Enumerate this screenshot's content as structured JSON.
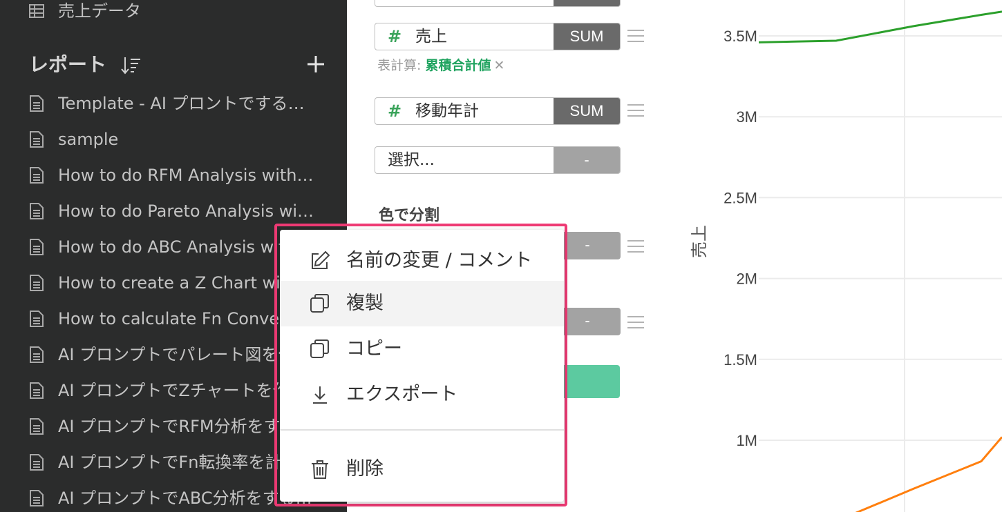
{
  "sidebar": {
    "top_item": "売上データ",
    "reports_title": "レポート",
    "reports": [
      "Template - AI プロントでするグラフの作成方法",
      "sample",
      "How to do RFM Analysis with AI Prompt",
      "How to do Pareto Analysis with AI Prompt",
      "How to do ABC Analysis with AI Prompt",
      "How to create a Z Chart with AI Prompt",
      "How to calculate Fn Conversion Rate with AI Prompt",
      "AI プロンプトでパレート図を作成する方法",
      "AI プロンプトでZチャートを作成する方法",
      "AI プロンプトでRFM分析をする方法",
      "AI プロンプトでFn転換率を計算する方法",
      "AI プロンプトでABC分析をする方法"
    ]
  },
  "panel": {
    "fields": [
      {
        "hash": "#",
        "name": "売上",
        "agg": "SUM"
      },
      {
        "hash": "#",
        "name": "移動年計",
        "agg": "SUM"
      }
    ],
    "select_placeholder": "選択...",
    "select_agg": "-",
    "dash": "-",
    "table_calc_label": "表計算: ",
    "table_calc_value": "累積合計値",
    "remove_symbol": "✕",
    "color_split_label": "色で分割"
  },
  "chart_data": {
    "type": "line",
    "ylabel": "売上",
    "yticks": [
      "3.5M",
      "3M",
      "2.5M",
      "2M",
      "1.5M",
      "1M"
    ],
    "ylim": [
      600000,
      3650000
    ],
    "grid": true,
    "series": [
      {
        "color": "#2ca02c",
        "values": [
          3460000,
          3470000,
          3560000,
          3630000,
          3650000
        ]
      },
      {
        "color": "#ff7f0e",
        "values": [
          400000,
          500000,
          700000,
          870000,
          1020000
        ]
      }
    ]
  },
  "context_menu": {
    "items": [
      {
        "label": "名前の変更 / コメント",
        "icon": "edit-icon"
      },
      {
        "label": "複製",
        "icon": "duplicate-icon"
      },
      {
        "label": "コピー",
        "icon": "copy-icon"
      },
      {
        "label": "エクスポート",
        "icon": "download-icon"
      }
    ],
    "delete_label": "削除",
    "highlight_color": "#ee3a74"
  }
}
